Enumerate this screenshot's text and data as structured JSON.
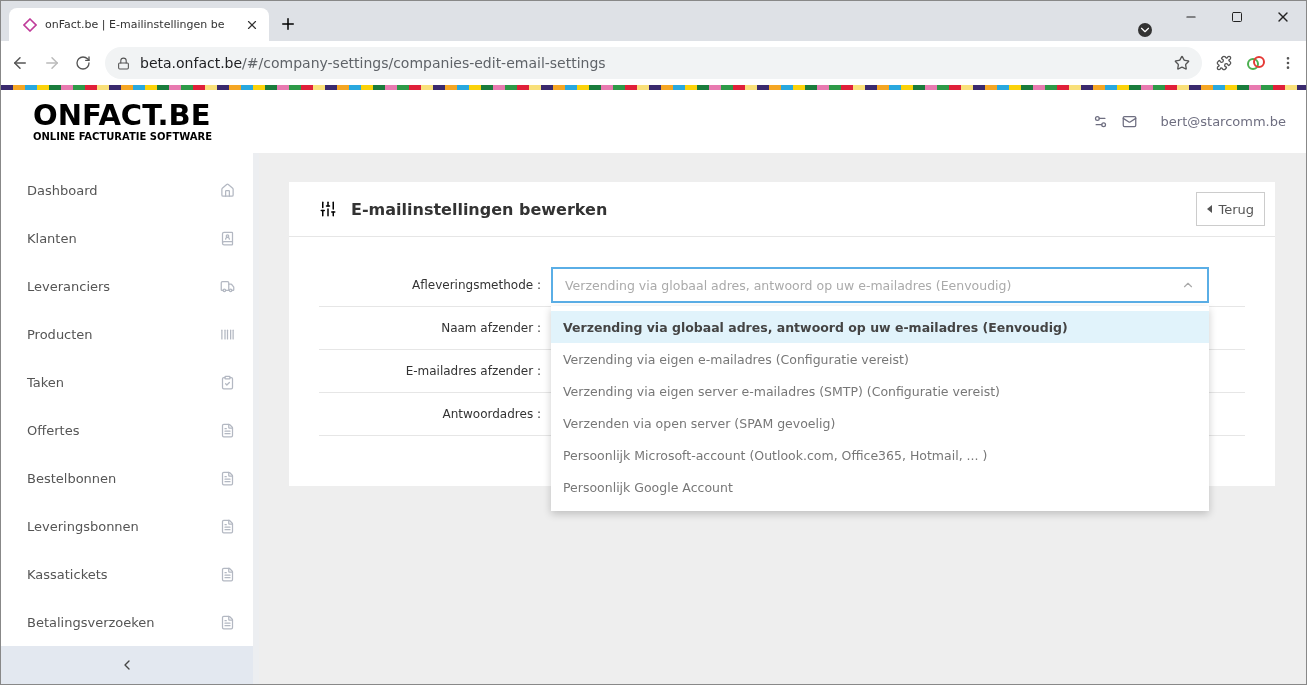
{
  "browser": {
    "tab_title": "onFact.be | E-mailinstellingen be",
    "url_host": "beta.onfact.be",
    "url_path": "/#/company-settings/companies-edit-email-settings"
  },
  "header": {
    "logo_title": "ONFACT.BE",
    "logo_subtitle": "ONLINE FACTURATIE SOFTWARE",
    "user": "bert@starcomm.be"
  },
  "sidebar": {
    "items": [
      {
        "label": "Dashboard",
        "kind": "home"
      },
      {
        "label": "Klanten",
        "kind": "contacts"
      },
      {
        "label": "Leveranciers",
        "kind": "truck"
      },
      {
        "label": "Producten",
        "kind": "barcode"
      },
      {
        "label": "Taken",
        "kind": "clipboard"
      },
      {
        "label": "Offertes",
        "kind": "pdf"
      },
      {
        "label": "Bestelbonnen",
        "kind": "pdf"
      },
      {
        "label": "Leveringsbonnen",
        "kind": "pdf"
      },
      {
        "label": "Kassatickets",
        "kind": "pdf"
      },
      {
        "label": "Betalingsverzoeken",
        "kind": "pdf"
      }
    ]
  },
  "card": {
    "title": "E-mailinstellingen bewerken",
    "back_button": "Terug",
    "fields": [
      {
        "label": "Afleveringsmethode :",
        "kind": "select",
        "placeholder": "Verzending via globaal adres, antwoord op uw e-mailadres (Eenvoudig)",
        "expanded": true
      },
      {
        "label": "Naam afzender :",
        "kind": "text"
      },
      {
        "label": "E-mailadres afzender :",
        "kind": "text"
      },
      {
        "label": "Antwoordadres :",
        "kind": "text"
      }
    ],
    "options": [
      {
        "label": "Verzending via globaal adres, antwoord op uw e-mailadres (Eenvoudig)",
        "selected": true
      },
      {
        "label": "Verzending via eigen e-mailadres (Configuratie vereist)",
        "selected": false
      },
      {
        "label": "Verzending via eigen server e-mailadres (SMTP) (Configuratie vereist)",
        "selected": false
      },
      {
        "label": "Verzenden via open server (SPAM gevoelig)",
        "selected": false
      },
      {
        "label": "Persoonlijk Microsoft-account (Outlook.com, Office365, Hotmail, ... )",
        "selected": false
      },
      {
        "label": "Persoonlijk Google Account",
        "selected": false
      }
    ]
  }
}
